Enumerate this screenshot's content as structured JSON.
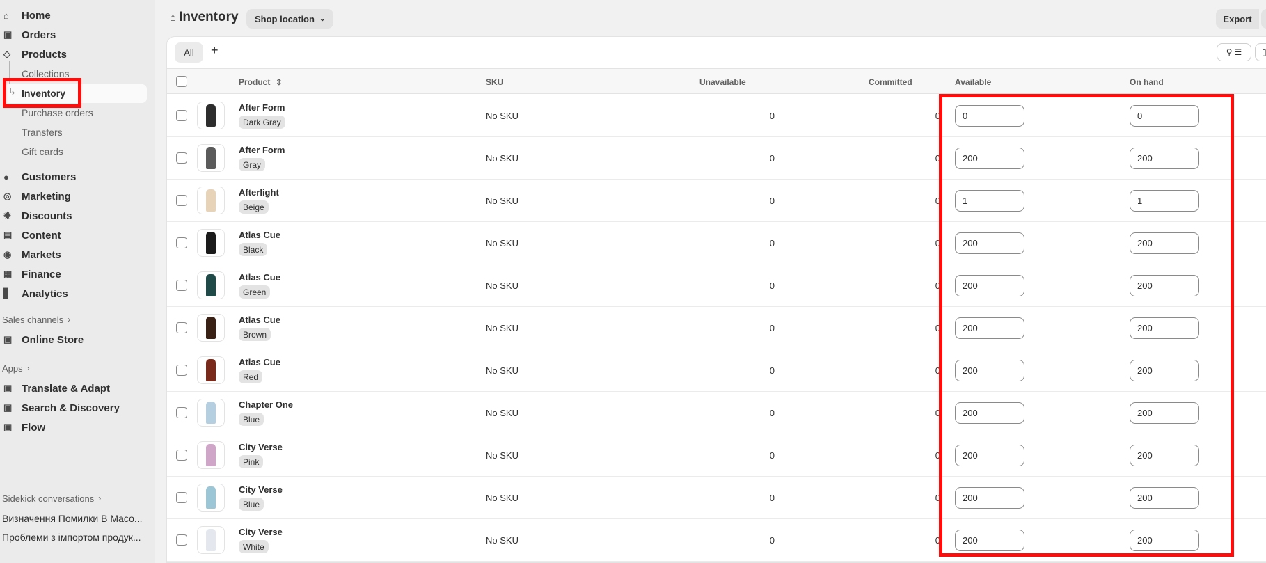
{
  "sidebar": {
    "nav": [
      {
        "label": "Home",
        "icon": "home-icon"
      },
      {
        "label": "Orders",
        "icon": "inbox-icon"
      },
      {
        "label": "Products",
        "icon": "tag-icon"
      }
    ],
    "product_sub": [
      "Collections",
      "Inventory",
      "Purchase orders",
      "Transfers",
      "Gift cards"
    ],
    "nav2": [
      {
        "label": "Customers",
        "icon": "person-icon"
      },
      {
        "label": "Marketing",
        "icon": "target-icon"
      },
      {
        "label": "Discounts",
        "icon": "discount-icon"
      },
      {
        "label": "Content",
        "icon": "content-icon"
      },
      {
        "label": "Markets",
        "icon": "globe-icon"
      },
      {
        "label": "Finance",
        "icon": "bank-icon"
      },
      {
        "label": "Analytics",
        "icon": "bar-chart-icon"
      }
    ],
    "sales_channels_label": "Sales channels",
    "online_store_label": "Online Store",
    "apps_label": "Apps",
    "apps": [
      "Translate & Adapt",
      "Search & Discovery",
      "Flow"
    ],
    "sidekick_label": "Sidekick conversations",
    "sidekick_items": [
      "Визначення Помилки В Масо...",
      "Проблеми з імпортом продук..."
    ]
  },
  "header": {
    "title": "Inventory",
    "location_button": "Shop location",
    "export_button": "Export"
  },
  "tabs": {
    "all": "All",
    "add": "+"
  },
  "table": {
    "columns": {
      "product": "Product",
      "sku": "SKU",
      "unavailable": "Unavailable",
      "committed": "Committed",
      "available": "Available",
      "on_hand": "On hand"
    },
    "rows": [
      {
        "name": "After Form",
        "variant": "Dark Gray",
        "sku": "No SKU",
        "unavailable": "0",
        "committed": "0",
        "available": "0",
        "on_hand": "0",
        "color": "#2d2d2d"
      },
      {
        "name": "After Form",
        "variant": "Gray",
        "sku": "No SKU",
        "unavailable": "0",
        "committed": "0",
        "available": "200",
        "on_hand": "200",
        "color": "#5b5b5b"
      },
      {
        "name": "Afterlight",
        "variant": "Beige",
        "sku": "No SKU",
        "unavailable": "0",
        "committed": "0",
        "available": "1",
        "on_hand": "1",
        "color": "#e6d3b8"
      },
      {
        "name": "Atlas Cue",
        "variant": "Black",
        "sku": "No SKU",
        "unavailable": "0",
        "committed": "0",
        "available": "200",
        "on_hand": "200",
        "color": "#1b1b1b"
      },
      {
        "name": "Atlas Cue",
        "variant": "Green",
        "sku": "No SKU",
        "unavailable": "0",
        "committed": "0",
        "available": "200",
        "on_hand": "200",
        "color": "#1f4a48"
      },
      {
        "name": "Atlas Cue",
        "variant": "Brown",
        "sku": "No SKU",
        "unavailable": "0",
        "committed": "0",
        "available": "200",
        "on_hand": "200",
        "color": "#3a2116"
      },
      {
        "name": "Atlas Cue",
        "variant": "Red",
        "sku": "No SKU",
        "unavailable": "0",
        "committed": "0",
        "available": "200",
        "on_hand": "200",
        "color": "#7a2a1a"
      },
      {
        "name": "Chapter One",
        "variant": "Blue",
        "sku": "No SKU",
        "unavailable": "0",
        "committed": "0",
        "available": "200",
        "on_hand": "200",
        "color": "#b5cfe0"
      },
      {
        "name": "City Verse",
        "variant": "Pink",
        "sku": "No SKU",
        "unavailable": "0",
        "committed": "0",
        "available": "200",
        "on_hand": "200",
        "color": "#cfa6c8"
      },
      {
        "name": "City Verse",
        "variant": "Blue",
        "sku": "No SKU",
        "unavailable": "0",
        "committed": "0",
        "available": "200",
        "on_hand": "200",
        "color": "#9cc6d6"
      },
      {
        "name": "City Verse",
        "variant": "White",
        "sku": "No SKU",
        "unavailable": "0",
        "committed": "0",
        "available": "200",
        "on_hand": "200",
        "color": "#e4e8ee"
      }
    ]
  },
  "accent": {
    "highlight": "#ff0d0d"
  }
}
